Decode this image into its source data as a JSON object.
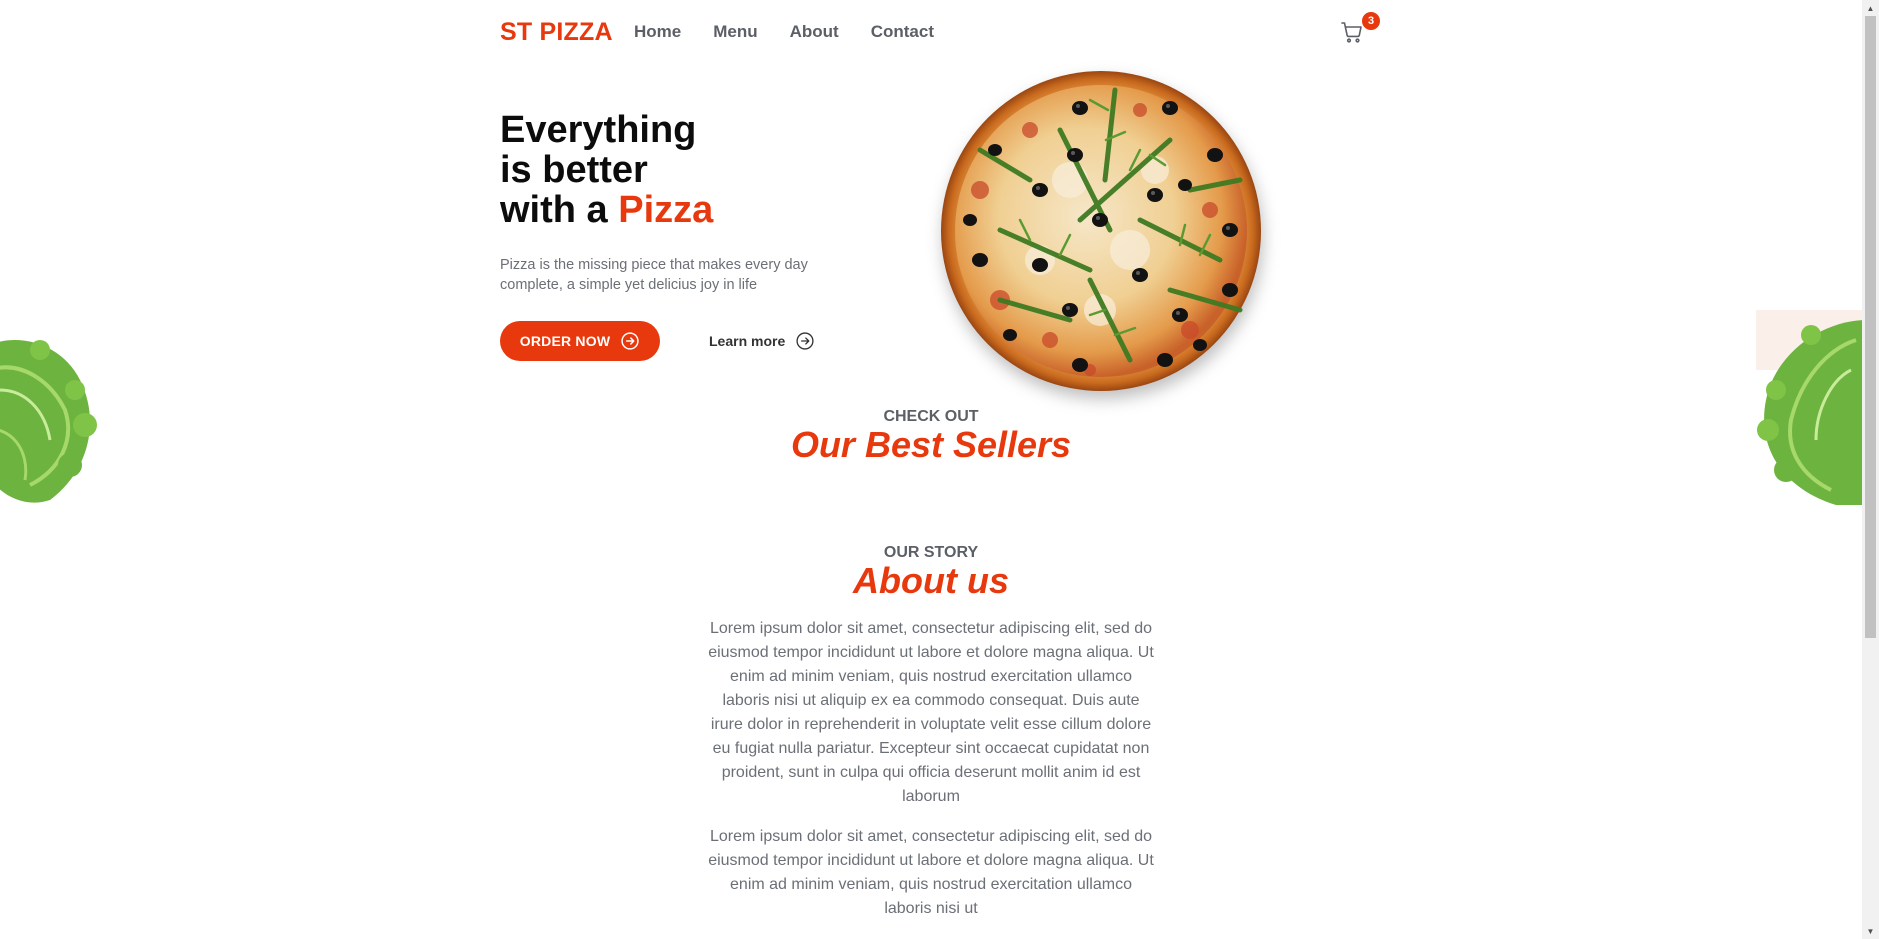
{
  "header": {
    "logo": "ST PIZZA",
    "nav": [
      "Home",
      "Menu",
      "About",
      "Contact"
    ],
    "cart_count": "3",
    "cart_icon": "cart-icon"
  },
  "hero": {
    "title_line1": "Everything",
    "title_line2": "is better",
    "title_line3_prefix": "with a ",
    "title_line3_accent": "Pizza",
    "description": "Pizza is the missing piece that makes every day complete, a simple yet delicius joy in life",
    "order_button": "ORDER NOW",
    "learn_button": "Learn more",
    "button_icon": "arrow-circle-right-icon"
  },
  "best_sellers": {
    "subtitle": "CHECK OUT",
    "title": "Our Best Sellers"
  },
  "about": {
    "subtitle": "OUR STORY",
    "title": "About us",
    "paragraph1": "Lorem ipsum dolor sit amet, consectetur adipiscing elit, sed do eiusmod tempor incididunt ut labore et dolore magna aliqua. Ut enim ad minim veniam, quis nostrud exercitation ullamco laboris nisi ut aliquip ex ea commodo consequat. Duis aute irure dolor in reprehenderit in voluptate velit esse cillum dolore eu fugiat nulla pariatur. Excepteur sint occaecat cupidatat non proident, sunt in culpa qui officia deserunt mollit anim id est laborum",
    "paragraph2": "Lorem ipsum dolor sit amet, consectetur adipiscing elit, sed do eiusmod tempor incididunt ut labore et dolore magna aliqua. Ut enim ad minim veniam, quis nostrud exercitation ullamco laboris nisi ut"
  },
  "colors": {
    "accent": "#e8380d",
    "nav_text": "#5b5f66",
    "body_text": "#6b6f76"
  }
}
